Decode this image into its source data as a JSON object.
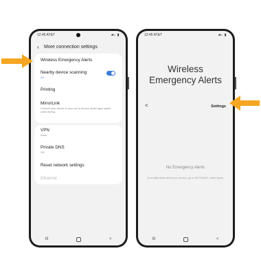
{
  "left_phone": {
    "status": {
      "time": "12:45 AT&T",
      "signal": "▰ᵢₗ ▮"
    },
    "header": {
      "back_glyph": "‹",
      "title": "More connection settings"
    },
    "group1": [
      {
        "title": "Wireless Emergency Alerts",
        "sub": ""
      },
      {
        "title": "Nearby device scanning",
        "sub": "On",
        "toggle": true
      },
      {
        "title": "Printing",
        "sub": ""
      },
      {
        "title": "MirrorLink",
        "sub": "Connect your device to your car to access useful apps safely while driving."
      }
    ],
    "group2": [
      {
        "title": "VPN",
        "sub": "None"
      },
      {
        "title": "Private DNS",
        "sub": "Off"
      },
      {
        "title": "Reset network settings",
        "sub": ""
      },
      {
        "title": "Ethernet",
        "sub": "",
        "disabled": true
      }
    ],
    "nav": {
      "recent": "III",
      "back": "<"
    }
  },
  "right_phone": {
    "status": {
      "time": "12:45 AT&T",
      "signal": "▰ᵢₗ ▮"
    },
    "title_line1": "Wireless",
    "title_line2": "Emergency Alerts",
    "back_glyph": "<",
    "settings_label": "Settings",
    "empty_title": "No Emergency Alerts",
    "empty_sub": "To modify which alerts you receive, go to SETTINGS > Alert types.",
    "nav": {
      "recent": "III",
      "back": "<"
    }
  },
  "colors": {
    "arrow": "#f5a623",
    "accent": "#3e7bd6"
  }
}
